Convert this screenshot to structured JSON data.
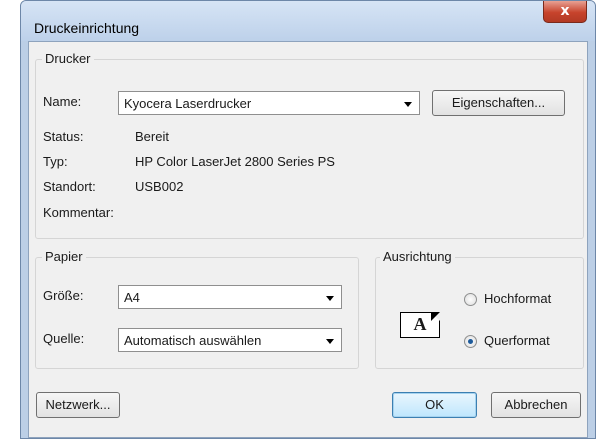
{
  "window": {
    "title": "Druckeinrichtung",
    "close_glyph": "x"
  },
  "printer": {
    "group_label": "Drucker",
    "name_label": "Name:",
    "name_value": "Kyocera Laserdrucker",
    "properties_button": "Eigenschaften...",
    "status_label": "Status:",
    "status_value": "Bereit",
    "type_label": "Typ:",
    "type_value": "HP Color LaserJet 2800 Series PS",
    "location_label": "Standort:",
    "location_value": "USB002",
    "comment_label": "Kommentar:",
    "comment_value": ""
  },
  "paper": {
    "group_label": "Papier",
    "size_label": "Größe:",
    "size_value": "A4",
    "source_label": "Quelle:",
    "source_value": "Automatisch auswählen"
  },
  "orientation": {
    "group_label": "Ausrichtung",
    "icon_letter": "A",
    "portrait_label": "Hochformat",
    "portrait_selected": false,
    "landscape_label": "Querformat",
    "landscape_selected": true
  },
  "buttons": {
    "network": "Netzwerk...",
    "ok": "OK",
    "cancel": "Abbrechen"
  }
}
